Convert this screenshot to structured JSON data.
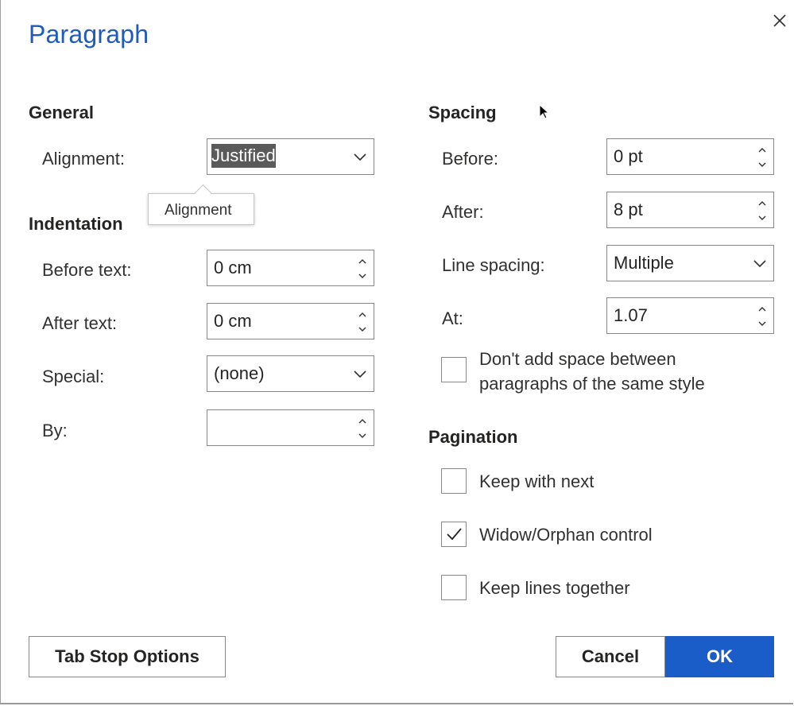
{
  "dialog": {
    "title": "Paragraph",
    "close_icon": "close-icon"
  },
  "general": {
    "heading": "General",
    "alignment_label": "Alignment:",
    "alignment_value": "Justified",
    "tooltip": "Alignment"
  },
  "indentation": {
    "heading": "Indentation",
    "before_text_label": "Before text:",
    "before_text_value": "0 cm",
    "after_text_label": "After text:",
    "after_text_value": "0 cm",
    "special_label": "Special:",
    "special_value": "(none)",
    "by_label": "By:",
    "by_value": ""
  },
  "spacing": {
    "heading": "Spacing",
    "before_label": "Before:",
    "before_value": "0 pt",
    "after_label": "After:",
    "after_value": "8 pt",
    "line_spacing_label": "Line spacing:",
    "line_spacing_value": "Multiple",
    "at_label": "At:",
    "at_value": "1.07",
    "dont_add_space_label_line1": "Don't add space between",
    "dont_add_space_label_line2": "paragraphs of the same style",
    "dont_add_space_checked": false
  },
  "pagination": {
    "heading": "Pagination",
    "keep_with_next_label": "Keep with next",
    "keep_with_next_checked": false,
    "widow_orphan_label": "Widow/Orphan control",
    "widow_orphan_checked": true,
    "keep_lines_together_label": "Keep lines together",
    "keep_lines_together_checked": false
  },
  "footer": {
    "tab_stop_label": "Tab Stop Options",
    "cancel_label": "Cancel",
    "ok_label": "OK"
  },
  "colors": {
    "accent": "#1a5cc8",
    "title": "#1f5bbb",
    "border": "#8a8886"
  }
}
